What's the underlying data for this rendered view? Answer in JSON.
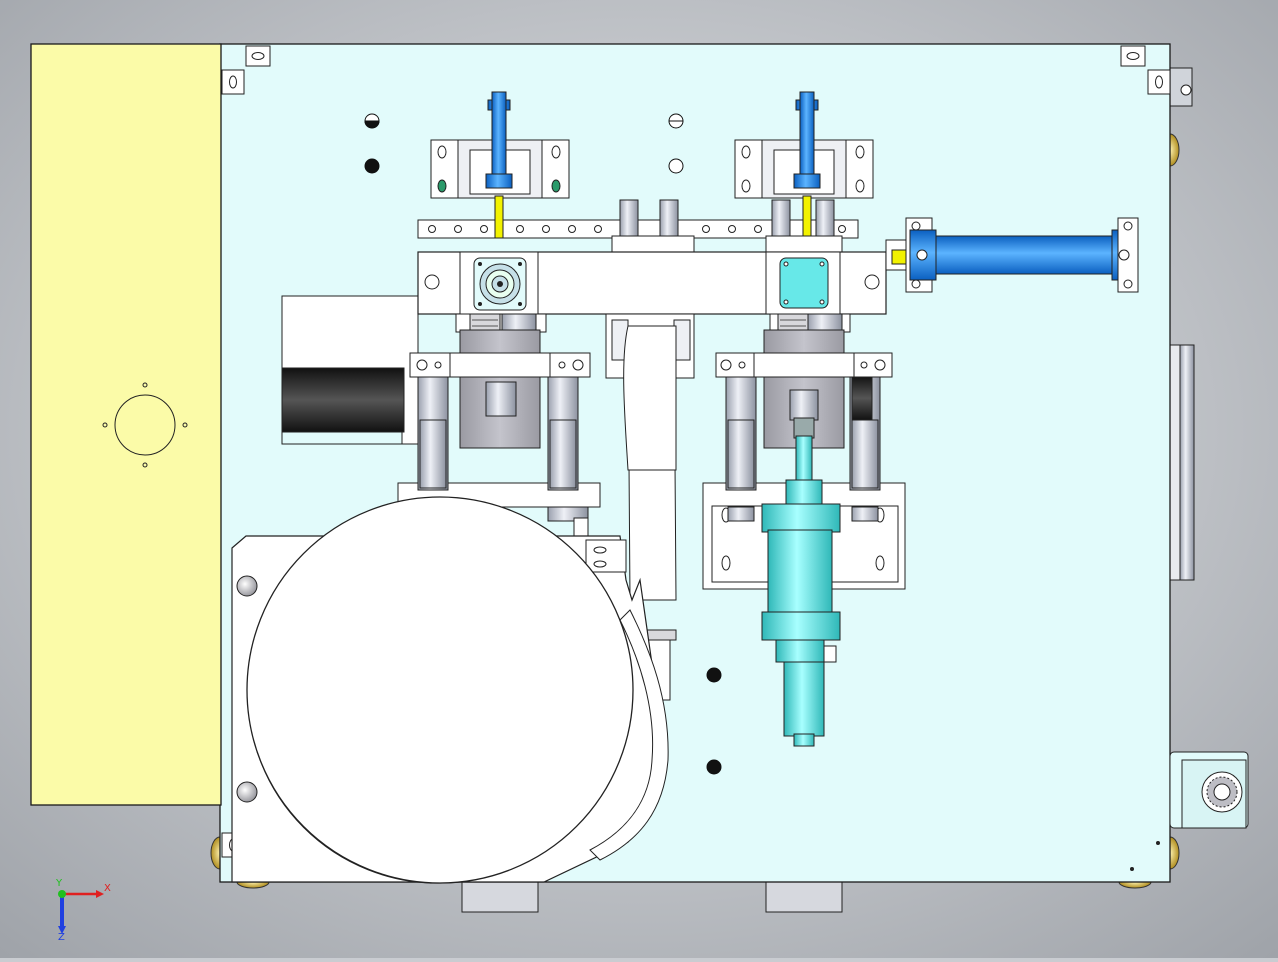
{
  "viewport": {
    "background": "#c9ccd1",
    "background_edge": "#9ea2a8"
  },
  "colors": {
    "base_plate": "#e2fbfb",
    "side_panel": "#fbfba8",
    "part_white": "#ffffff",
    "part_grey": "#d8d8dc",
    "steel": "#c8ccd6",
    "cylinder_blue": "#1e90ff",
    "cylinder_cyan": "#67e8e8",
    "dark_part": "#2a2a2a",
    "brass": "#d4b64a",
    "axis_x": "#e02020",
    "axis_y": "#20c020",
    "axis_z": "#2040e0",
    "outline": "#1a1a1a"
  },
  "triad": {
    "x_label": "X",
    "y_label": "Y",
    "z_label": "Z"
  },
  "icons": {
    "orientation": "orientation-triad-icon"
  }
}
